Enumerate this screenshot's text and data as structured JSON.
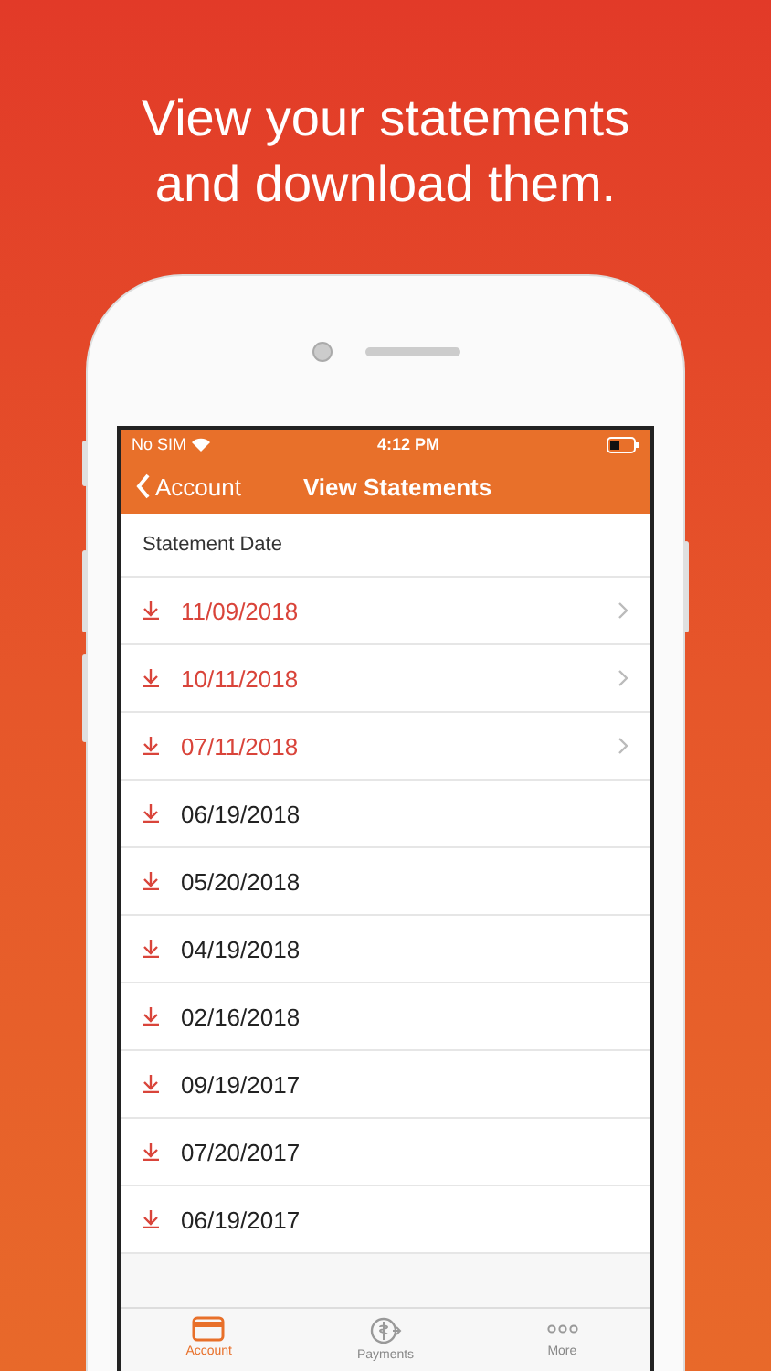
{
  "headline": "View your statements and download them.",
  "status_bar": {
    "carrier": "No SIM",
    "time": "4:12 PM"
  },
  "nav_bar": {
    "back": "Account",
    "title": "View Statements"
  },
  "list_header": "Statement Date",
  "statements": [
    {
      "date": "11/09/2018",
      "highlighted": true
    },
    {
      "date": "10/11/2018",
      "highlighted": true
    },
    {
      "date": "07/11/2018",
      "highlighted": true
    },
    {
      "date": "06/19/2018",
      "highlighted": false
    },
    {
      "date": "05/20/2018",
      "highlighted": false
    },
    {
      "date": "04/19/2018",
      "highlighted": false
    },
    {
      "date": "02/16/2018",
      "highlighted": false
    },
    {
      "date": "09/19/2017",
      "highlighted": false
    },
    {
      "date": "07/20/2017",
      "highlighted": false
    },
    {
      "date": "06/19/2017",
      "highlighted": false
    }
  ],
  "tab_bar": [
    {
      "label": "Account",
      "kind": "card",
      "selected": true
    },
    {
      "label": "Payments",
      "kind": "payment",
      "selected": false
    },
    {
      "label": "More",
      "kind": "more",
      "selected": false
    }
  ]
}
